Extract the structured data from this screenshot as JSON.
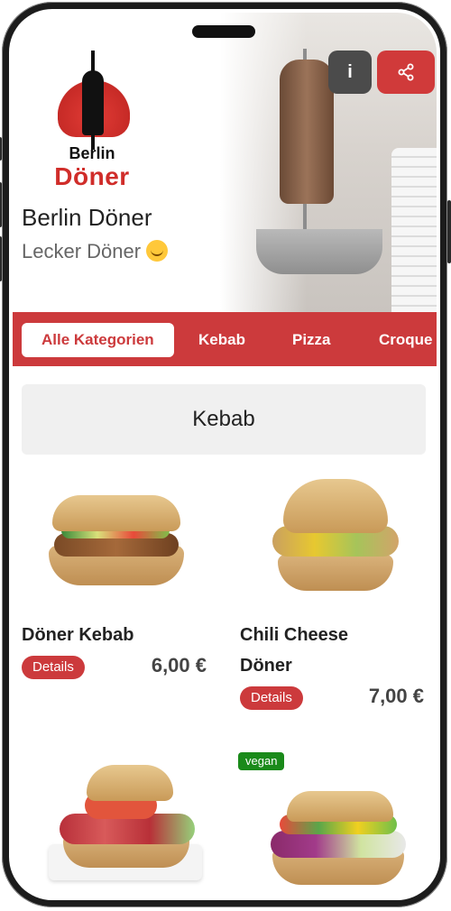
{
  "restaurant": {
    "logo_line1": "Berlin",
    "logo_line2": "Döner",
    "name": "Berlin Döner",
    "tagline": "Lecker Döner",
    "emoji": "😋"
  },
  "header_buttons": {
    "info_label": "i"
  },
  "tabs": [
    {
      "label": "Alle Kategorien",
      "active": true
    },
    {
      "label": "Kebab",
      "active": false
    },
    {
      "label": "Pizza",
      "active": false
    },
    {
      "label": "Croque",
      "active": false
    }
  ],
  "section": {
    "title": "Kebab"
  },
  "products": [
    {
      "name": "Döner Kebab",
      "details_label": "Details",
      "price": "6,00 €",
      "badge": ""
    },
    {
      "name_line1": "Chili Cheese",
      "name_line2": "Döner",
      "details_label": "Details",
      "price": "7,00 €",
      "badge": ""
    },
    {
      "name": "",
      "details_label": "",
      "price": "",
      "badge": ""
    },
    {
      "name": "",
      "details_label": "",
      "price": "",
      "badge": "vegan"
    }
  ],
  "colors": {
    "brand": "#cc3a3c",
    "info_button": "#4b4b4b",
    "vegan_badge": "#1a8a1a"
  }
}
